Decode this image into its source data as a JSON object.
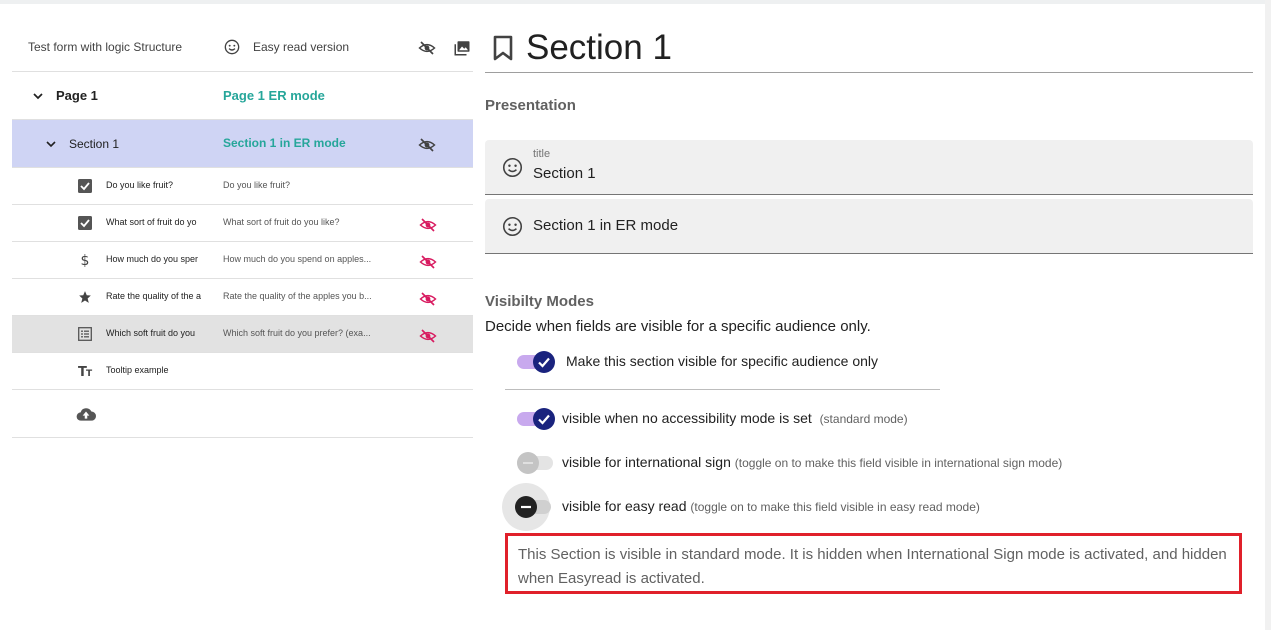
{
  "tree": {
    "header": {
      "title": "Test form with logic Structure",
      "easy_read": "Easy read version"
    },
    "page": {
      "name": "Page 1",
      "er_name": "Page 1 ER mode"
    },
    "section": {
      "name": "Section 1",
      "er_name": "Section 1 in ER mode"
    },
    "questions": [
      {
        "icon": "checkbox-icon",
        "name": "Do you like fruit?",
        "er": "Do you like fruit?",
        "hidden": false
      },
      {
        "icon": "checkbox-icon",
        "name": "What sort of fruit do yo",
        "er": "What sort of fruit do you like?",
        "hidden": true
      },
      {
        "icon": "dollar-icon",
        "name": "How much do you sper",
        "er": "How much do you spend on apples...",
        "hidden": true
      },
      {
        "icon": "star-icon",
        "name": "Rate the quality of the a",
        "er": "Rate the quality of the apples you b...",
        "hidden": true
      },
      {
        "icon": "list-icon",
        "name": "Which soft fruit do you",
        "er": "Which soft fruit do you prefer? (exa...",
        "hidden": true
      },
      {
        "icon": "text-icon",
        "name": "Tooltip example",
        "er": "",
        "hidden": false
      }
    ]
  },
  "detail": {
    "title": "Section 1",
    "presentation_heading": "Presentation",
    "title_field": {
      "label": "title",
      "value": "Section 1"
    },
    "er_field": {
      "value": "Section 1 in ER mode"
    },
    "visibility": {
      "heading": "Visibilty Modes",
      "description": "Decide when fields are visible for a specific audience only.",
      "specific_audience": {
        "label": "Make this section visible for specific audience only",
        "on": true
      },
      "standard": {
        "label": "visible when no accessibility mode is set",
        "hint": "(standard mode)",
        "on": true
      },
      "intl_sign": {
        "label": "visible for international sign",
        "hint": "(toggle on to make this field visible in international sign mode)",
        "on": false
      },
      "easy_read": {
        "label": "visible for easy read",
        "hint": "(toggle on to make this field visible in easy read mode)",
        "on": false
      }
    },
    "notice": "This Section is visible in standard mode. It is hidden when International Sign mode is activated, and hidden when Easyread is activated."
  },
  "colors": {
    "accent_teal": "#26a69a",
    "selected_section": "#cfd4f4",
    "hidden_eye": "#d81b60",
    "toggle_on": "#1a237e",
    "notice_border": "#e0202a"
  }
}
